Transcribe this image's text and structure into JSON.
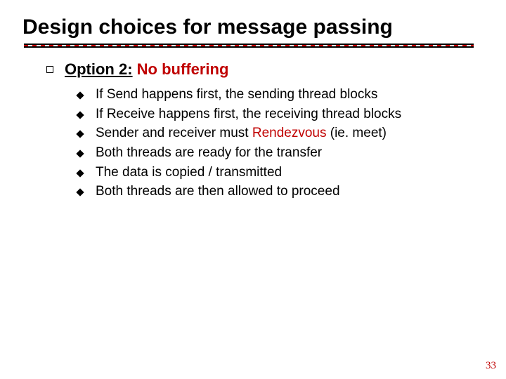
{
  "title": "Design choices for message passing",
  "lvl1": {
    "prefix": "Option 2:",
    "highlight": "No buffering"
  },
  "bullets": [
    {
      "pre": "If Send happens first, the sending thread blocks",
      "hl": "",
      "post": ""
    },
    {
      "pre": "If Receive happens first, the receiving thread blocks",
      "hl": "",
      "post": ""
    },
    {
      "pre": "Sender and receiver must ",
      "hl": "Rendezvous",
      "post": " (ie. meet)"
    },
    {
      "pre": "Both threads are ready for the transfer",
      "hl": "",
      "post": ""
    },
    {
      "pre": "The data is copied / transmitted",
      "hl": "",
      "post": ""
    },
    {
      "pre": "Both threads are then allowed to proceed",
      "hl": "",
      "post": ""
    }
  ],
  "page_number": "33"
}
